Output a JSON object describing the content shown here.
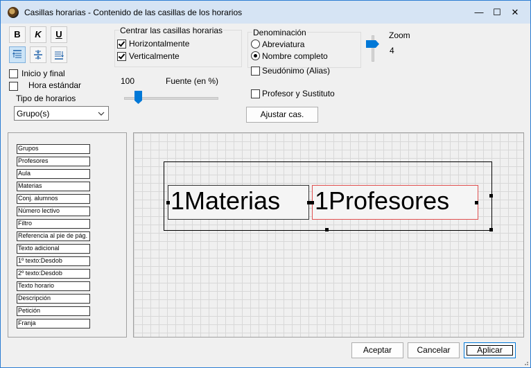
{
  "window": {
    "title": "Casillas horarias - Contenido de las casillas de los horarios",
    "minimize": "—",
    "maximize": "☐",
    "close": "✕"
  },
  "toolbar": {
    "bold": "B",
    "italic": "K",
    "underline": "U"
  },
  "options": {
    "inicio_final": "Inicio y final",
    "hora_estandar": "Hora estándar"
  },
  "centrar": {
    "title": "Centrar las casillas horarias",
    "horizontal": "Horizontalmente",
    "vertical": "Verticalmente"
  },
  "fuente": {
    "value": "100",
    "label": "Fuente (en %)",
    "slider_percent": 15
  },
  "tipo": {
    "label": "Tipo de horarios",
    "selected": "Grupo(s)"
  },
  "denominacion": {
    "title": "Denominación",
    "abreviatura": "Abreviatura",
    "nombre_completo": "Nombre completo",
    "seudonimo": "Seudónimo (Alias)"
  },
  "profesor_sustituto": "Profesor y Sustituto",
  "ajustar": "Ajustar cas.",
  "zoom": {
    "label": "Zoom",
    "value": "4"
  },
  "fields": [
    "Grupos",
    "Profesores",
    "Aula",
    "Materias",
    "Conj. alumnos",
    "Número lectivo",
    "Filtro",
    "Referencia al pie de pág.",
    "Texto adicional",
    "1º texto:Desdob",
    "2º texto:Desdob",
    "Texto horario",
    "Descripción",
    "Petición",
    "Franja"
  ],
  "preview": {
    "cell1": "1Materias",
    "cell2": "1Profesores"
  },
  "footer": {
    "ok": "Aceptar",
    "cancel": "Cancelar",
    "apply": "Aplicar"
  },
  "colors": {
    "accent": "#0078d7",
    "selected_cell_border": "#e05050",
    "titlebar": "#d6e4f4"
  }
}
